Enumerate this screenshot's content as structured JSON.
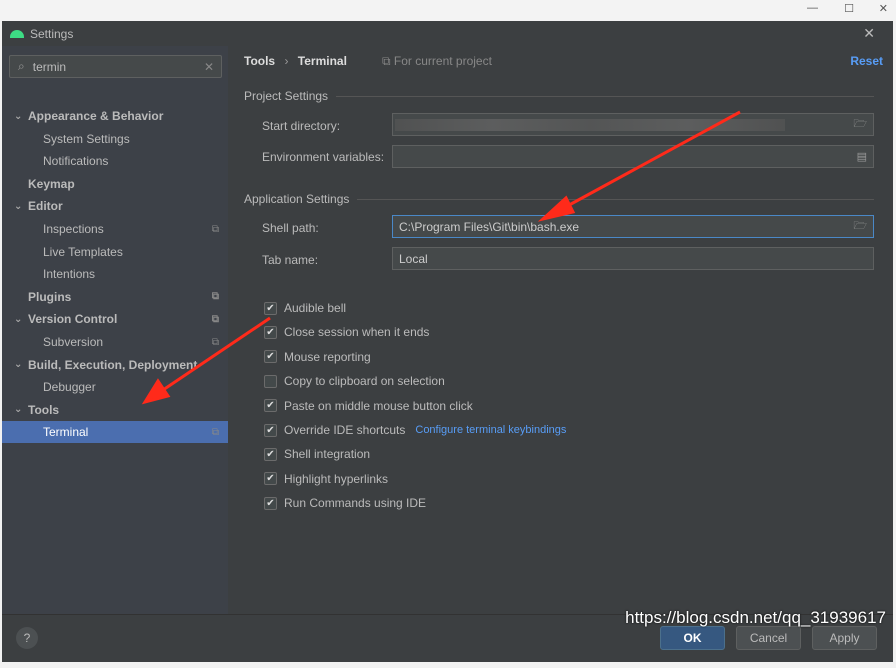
{
  "window": {
    "title": "Settings",
    "controls": [
      "—",
      "☐",
      "✕"
    ]
  },
  "search": {
    "value": "termin"
  },
  "sidebar": {
    "items": [
      {
        "label": "Appearance & Behavior",
        "bold": true,
        "chev": true,
        "indent": 0
      },
      {
        "label": "System Settings",
        "indent": 1
      },
      {
        "label": "Notifications",
        "indent": 1
      },
      {
        "label": "Keymap",
        "bold": true,
        "indent": 0
      },
      {
        "label": "Editor",
        "bold": true,
        "chev": true,
        "indent": 0
      },
      {
        "label": "Inspections",
        "indent": 1,
        "copy": true
      },
      {
        "label": "Live Templates",
        "indent": 1
      },
      {
        "label": "Intentions",
        "indent": 1
      },
      {
        "label": "Plugins",
        "bold": true,
        "indent": 0,
        "copy": true
      },
      {
        "label": "Version Control",
        "bold": true,
        "chev": true,
        "indent": 0,
        "copy": true
      },
      {
        "label": "Subversion",
        "indent": 1,
        "copy": true
      },
      {
        "label": "Build, Execution, Deployment",
        "bold": true,
        "chev": true,
        "indent": 0
      },
      {
        "label": "Debugger",
        "indent": 1
      },
      {
        "label": "Tools",
        "bold": true,
        "chev": true,
        "indent": 0
      },
      {
        "label": "Terminal",
        "indent": 1,
        "copy": true,
        "selected": true
      }
    ]
  },
  "header": {
    "crumb_parent": "Tools",
    "crumb_sep": "›",
    "crumb_current": "Terminal",
    "scope": "For current project",
    "reset": "Reset"
  },
  "project_settings": {
    "title": "Project Settings",
    "start_directory_label": "Start directory:",
    "env_label": "Environment variables:"
  },
  "app_settings": {
    "title": "Application Settings",
    "shell_path_label": "Shell path:",
    "shell_path": "C:\\Program Files\\Git\\bin\\bash.exe",
    "tab_name_label": "Tab name:",
    "tab_name": "Local"
  },
  "checkboxes": [
    {
      "label": "Audible bell",
      "checked": true
    },
    {
      "label": "Close session when it ends",
      "checked": true
    },
    {
      "label": "Mouse reporting",
      "checked": true
    },
    {
      "label": "Copy to clipboard on selection",
      "checked": false
    },
    {
      "label": "Paste on middle mouse button click",
      "checked": true
    },
    {
      "label": "Override IDE shortcuts",
      "checked": true,
      "link": "Configure terminal keybindings"
    },
    {
      "label": "Shell integration",
      "checked": true
    },
    {
      "label": "Highlight hyperlinks",
      "checked": true
    },
    {
      "label": "Run Commands using IDE",
      "checked": true
    }
  ],
  "footer": {
    "help": "?",
    "ok": "OK",
    "cancel": "Cancel",
    "apply": "Apply"
  },
  "watermark": "https://blog.csdn.net/qq_31939617",
  "colors": {
    "accent": "#4b6eaf",
    "link": "#589df6",
    "arrow": "#ff2a1a"
  }
}
